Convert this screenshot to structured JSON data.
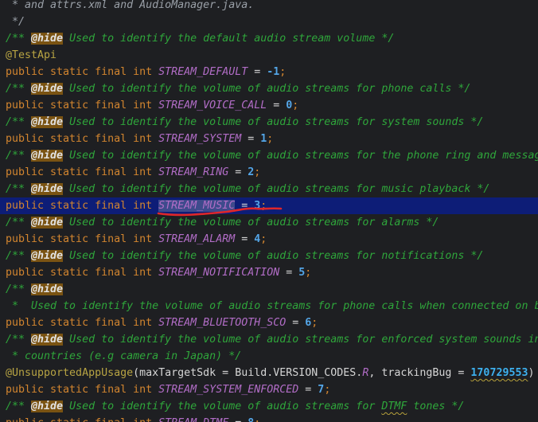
{
  "editor": {
    "current_line_index": 12,
    "lines": [
      [
        {
          "t": " * and attrs.xml and AudioManager.java.",
          "c": "gray"
        }
      ],
      [
        {
          "t": " */",
          "c": "gray"
        }
      ],
      [
        {
          "t": "/** ",
          "c": "comment"
        },
        {
          "t": "@hide",
          "c": "tag"
        },
        {
          "t": " Used to identify the default audio stream volume */",
          "c": "comment"
        }
      ],
      [
        {
          "t": "@TestApi",
          "c": "annotation"
        }
      ],
      [
        {
          "t": "public static final int ",
          "c": "keyword"
        },
        {
          "t": "STREAM_DEFAULT",
          "c": "field"
        },
        {
          "t": " = ",
          "c": "plain"
        },
        {
          "t": "-1",
          "c": "number"
        },
        {
          "t": ";",
          "c": "punct"
        }
      ],
      [
        {
          "t": "/** ",
          "c": "comment"
        },
        {
          "t": "@hide",
          "c": "tag"
        },
        {
          "t": " Used to identify the volume of audio streams for phone calls */",
          "c": "comment"
        }
      ],
      [
        {
          "t": "public static final int ",
          "c": "keyword"
        },
        {
          "t": "STREAM_VOICE_CALL",
          "c": "field"
        },
        {
          "t": " = ",
          "c": "plain"
        },
        {
          "t": "0",
          "c": "number"
        },
        {
          "t": ";",
          "c": "punct"
        }
      ],
      [
        {
          "t": "/** ",
          "c": "comment"
        },
        {
          "t": "@hide",
          "c": "tag"
        },
        {
          "t": " Used to identify the volume of audio streams for system sounds */",
          "c": "comment"
        }
      ],
      [
        {
          "t": "public static final int ",
          "c": "keyword"
        },
        {
          "t": "STREAM_SYSTEM",
          "c": "field"
        },
        {
          "t": " = ",
          "c": "plain"
        },
        {
          "t": "1",
          "c": "number"
        },
        {
          "t": ";",
          "c": "punct"
        }
      ],
      [
        {
          "t": "/** ",
          "c": "comment"
        },
        {
          "t": "@hide",
          "c": "tag"
        },
        {
          "t": " Used to identify the volume of audio streams for the phone ring and message alerts */",
          "c": "comment"
        }
      ],
      [
        {
          "t": "public static final int ",
          "c": "keyword"
        },
        {
          "t": "STREAM_RING",
          "c": "field"
        },
        {
          "t": " = ",
          "c": "plain"
        },
        {
          "t": "2",
          "c": "number"
        },
        {
          "t": ";",
          "c": "punct"
        }
      ],
      [
        {
          "t": "/** ",
          "c": "comment"
        },
        {
          "t": "@hide",
          "c": "tag"
        },
        {
          "t": " Used to identify the volume of audio streams for music playback */",
          "c": "comment"
        }
      ],
      [
        {
          "t": "public static final int ",
          "c": "keyword"
        },
        {
          "t": "STREAM_MUSIC",
          "c": "field selected"
        },
        {
          "t": " = ",
          "c": "plain"
        },
        {
          "t": "3",
          "c": "number"
        },
        {
          "t": ";",
          "c": "punct"
        }
      ],
      [
        {
          "t": "/** ",
          "c": "comment"
        },
        {
          "t": "@hide",
          "c": "tag"
        },
        {
          "t": " Used to identify the volume of audio streams for alarms */",
          "c": "comment"
        }
      ],
      [
        {
          "t": "public static final int ",
          "c": "keyword"
        },
        {
          "t": "STREAM_ALARM",
          "c": "field"
        },
        {
          "t": " = ",
          "c": "plain"
        },
        {
          "t": "4",
          "c": "number"
        },
        {
          "t": ";",
          "c": "punct"
        }
      ],
      [
        {
          "t": "/** ",
          "c": "comment"
        },
        {
          "t": "@hide",
          "c": "tag"
        },
        {
          "t": " Used to identify the volume of audio streams for notifications */",
          "c": "comment"
        }
      ],
      [
        {
          "t": "public static final int ",
          "c": "keyword"
        },
        {
          "t": "STREAM_NOTIFICATION",
          "c": "field"
        },
        {
          "t": " = ",
          "c": "plain"
        },
        {
          "t": "5",
          "c": "number"
        },
        {
          "t": ";",
          "c": "punct"
        }
      ],
      [
        {
          "t": "/** ",
          "c": "comment"
        },
        {
          "t": "@hide",
          "c": "tag"
        }
      ],
      [
        {
          "t": " *  Used to identify the volume of audio streams for phone calls when connected on bluetooth */",
          "c": "comment"
        }
      ],
      [
        {
          "t": "public static final int ",
          "c": "keyword"
        },
        {
          "t": "STREAM_BLUETOOTH_SCO",
          "c": "field"
        },
        {
          "t": " = ",
          "c": "plain"
        },
        {
          "t": "6",
          "c": "number"
        },
        {
          "t": ";",
          "c": "punct"
        }
      ],
      [
        {
          "t": "/** ",
          "c": "comment"
        },
        {
          "t": "@hide",
          "c": "tag"
        },
        {
          "t": " Used to identify the volume of audio streams for enforced system sounds in certain",
          "c": "comment"
        }
      ],
      [
        {
          "t": " * countries (e.g camera in Japan) */",
          "c": "comment"
        }
      ],
      [
        {
          "t": "@UnsupportedAppUsage",
          "c": "annotation"
        },
        {
          "t": "(maxTargetSdk = Build.VERSION_CODES.",
          "c": "plain"
        },
        {
          "t": "R",
          "c": "const"
        },
        {
          "t": ", trackingBug = ",
          "c": "plain"
        },
        {
          "t": "170729553",
          "c": "number-large squiggle"
        },
        {
          "t": ")",
          "c": "plain"
        }
      ],
      [
        {
          "t": "public static final int ",
          "c": "keyword"
        },
        {
          "t": "STREAM_SYSTEM_ENFORCED",
          "c": "field"
        },
        {
          "t": " = ",
          "c": "plain"
        },
        {
          "t": "7",
          "c": "number"
        },
        {
          "t": ";",
          "c": "punct"
        }
      ],
      [
        {
          "t": "/** ",
          "c": "comment"
        },
        {
          "t": "@hide",
          "c": "tag"
        },
        {
          "t": " Used to identify the volume of audio streams for ",
          "c": "comment"
        },
        {
          "t": "DTMF",
          "c": "comment squiggle"
        },
        {
          "t": " tones */",
          "c": "comment"
        }
      ],
      [
        {
          "t": "public static final int ",
          "c": "keyword"
        },
        {
          "t": "STREAM_DTMF",
          "c": "field"
        },
        {
          "t": " = ",
          "c": "plain"
        },
        {
          "t": "8",
          "c": "number"
        },
        {
          "t": ";",
          "c": "punct"
        }
      ]
    ]
  },
  "colors": {
    "background": "#1e1f22",
    "current_line": "#0d1d77",
    "comment": "#2fa63b",
    "keyword": "#d2852f",
    "field": "#b26dc7",
    "number": "#54a6e8",
    "annotation_stroke": "#e0262a"
  }
}
